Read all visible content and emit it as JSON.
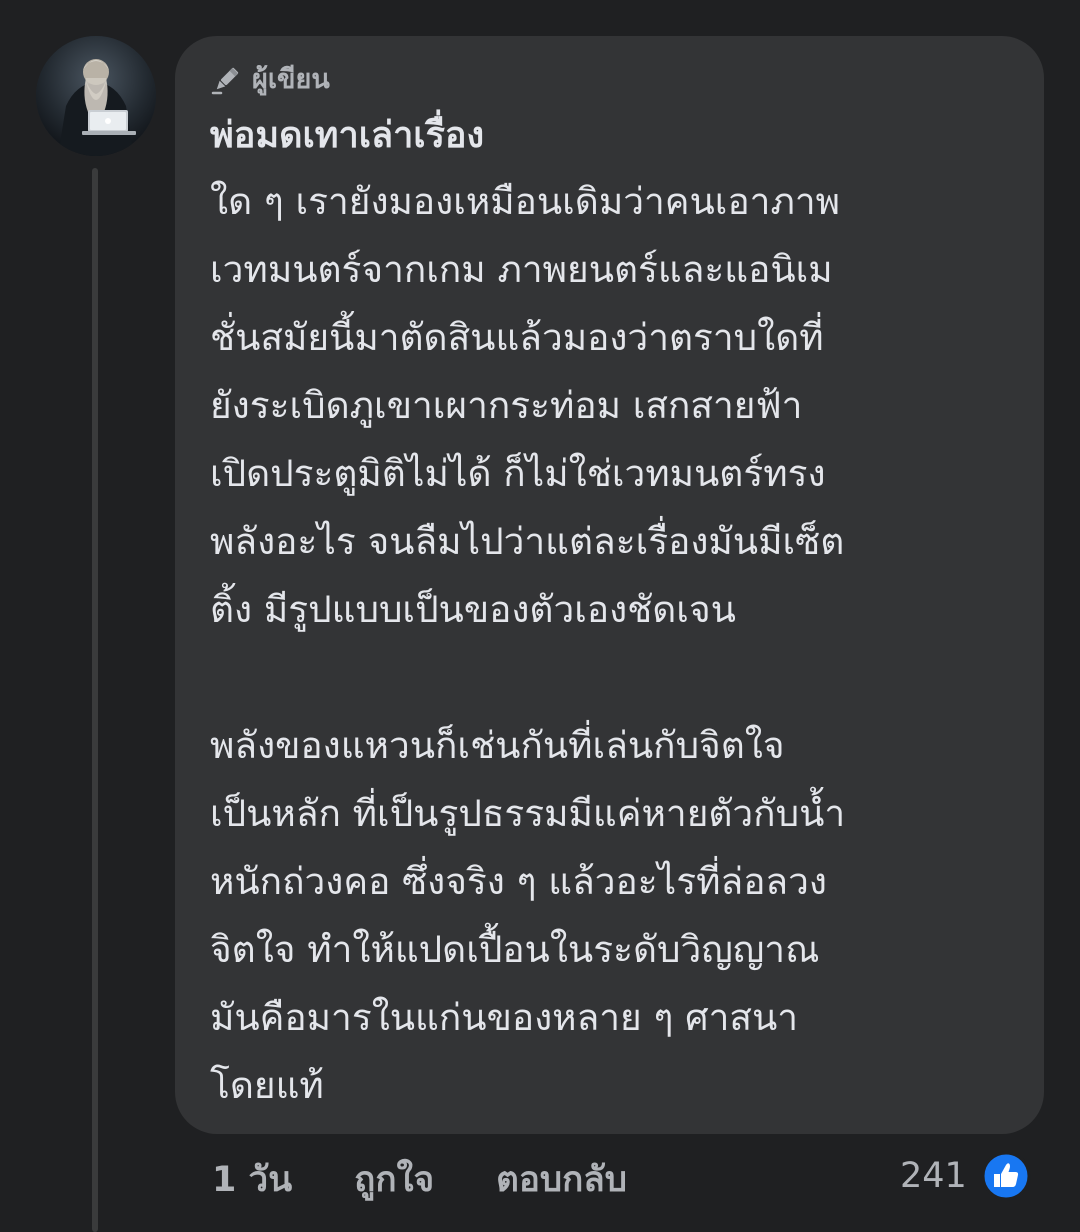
{
  "comment": {
    "badge": {
      "icon": "pencil-author-icon",
      "label": "ผู้เขียน"
    },
    "author": "พ่อมดเทาเล่าเรื่อง",
    "paragraphs": [
      [
        "ใด ๆ เรายังมองเหมือนเดิมว่าคนเอาภาพ",
        "เวทมนตร์จากเกม ภาพยนตร์และแอนิเม",
        "ชั่นสมัยนี้มาตัดสินแล้วมองว่าตราบใดที่",
        "ยังระเบิดภูเขาเผากระท่อม เสกสายฟ้า",
        "เปิดประตูมิติไม่ได้ ก็ไม่ใช่เวทมนตร์ทรง",
        "พลังอะไร จนลืมไปว่าแต่ละเรื่องมันมีเซ็ต",
        "ติ้ง มีรูปแบบเป็นของตัวเองชัดเจน"
      ],
      [
        "พลังของแหวนก็เช่นกันที่เล่นกับจิตใจ",
        "เป็นหลัก ที่เป็นรูปธรรมมีแค่หายตัวกับน้ำ",
        "หนักถ่วงคอ ซึ่งจริง ๆ แล้วอะไรที่ล่อลวง",
        "จิตใจ ทำให้แปดเปื้อนในระดับวิญญาณ",
        "มันคือมารในแก่นของหลาย ๆ ศาสนา",
        "โดยแท้"
      ]
    ]
  },
  "actions": {
    "time": "1 วัน",
    "like": "ถูกใจ",
    "reply": "ตอบกลับ"
  },
  "reactions": {
    "count": "241",
    "icon": "like-thumb-icon",
    "color": "#1877f2"
  },
  "colors": {
    "background": "#1f2022",
    "bubble": "#333436",
    "text": "#e4e6eb",
    "secondary": "#b0b3b8"
  }
}
